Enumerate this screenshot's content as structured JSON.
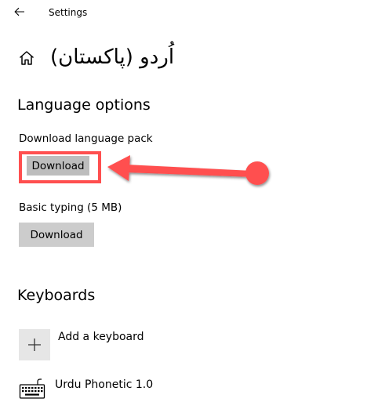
{
  "window": {
    "title": "Settings"
  },
  "header": {
    "title": "اُردو (پاکستان)"
  },
  "language_options": {
    "heading": "Language options",
    "language_pack_label": "Download language pack",
    "language_pack_button": "Download",
    "basic_typing_label": "Basic typing (5 MB)",
    "basic_typing_button": "Download"
  },
  "keyboards": {
    "heading": "Keyboards",
    "add_label": "Add a keyboard",
    "items": [
      {
        "label": "Urdu Phonetic 1.0"
      }
    ]
  },
  "icons": {
    "back": "back-arrow-icon",
    "home": "home-icon",
    "add": "plus-icon",
    "keyboard": "keyboard-icon"
  },
  "colors": {
    "annotation": "#ff4f4f",
    "button_bg": "#cccccc",
    "tile_bg": "#e6e6e6"
  }
}
